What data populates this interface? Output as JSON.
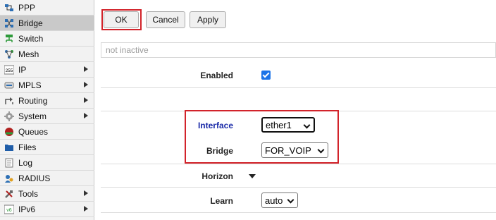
{
  "sidebar": {
    "items": [
      {
        "label": "PPP",
        "icon": "ppp-icon",
        "has_arrow": false,
        "active": false
      },
      {
        "label": "Bridge",
        "icon": "bridge-icon",
        "has_arrow": false,
        "active": true
      },
      {
        "label": "Switch",
        "icon": "switch-icon",
        "has_arrow": false,
        "active": false
      },
      {
        "label": "Mesh",
        "icon": "mesh-icon",
        "has_arrow": false,
        "active": false
      },
      {
        "label": "IP",
        "icon": "ip-icon",
        "has_arrow": true,
        "active": false
      },
      {
        "label": "MPLS",
        "icon": "mpls-icon",
        "has_arrow": true,
        "active": false
      },
      {
        "label": "Routing",
        "icon": "routing-icon",
        "has_arrow": true,
        "active": false
      },
      {
        "label": "System",
        "icon": "system-icon",
        "has_arrow": true,
        "active": false
      },
      {
        "label": "Queues",
        "icon": "queues-icon",
        "has_arrow": false,
        "active": false
      },
      {
        "label": "Files",
        "icon": "files-icon",
        "has_arrow": false,
        "active": false
      },
      {
        "label": "Log",
        "icon": "log-icon",
        "has_arrow": false,
        "active": false
      },
      {
        "label": "RADIUS",
        "icon": "radius-icon",
        "has_arrow": false,
        "active": false
      },
      {
        "label": "Tools",
        "icon": "tools-icon",
        "has_arrow": true,
        "active": false
      },
      {
        "label": "IPv6",
        "icon": "ipv6-icon",
        "has_arrow": true,
        "active": false
      }
    ],
    "ip_icon_text": "255",
    "ipv6_icon_text": "v6"
  },
  "toolbar": {
    "ok_label": "OK",
    "cancel_label": "Cancel",
    "apply_label": "Apply"
  },
  "status": {
    "text": "not inactive"
  },
  "form": {
    "enabled_label": "Enabled",
    "enabled_checked": true,
    "interface_label": "Interface",
    "interface_value": "ether1",
    "bridge_label": "Bridge",
    "bridge_value": "FOR_VOIP",
    "horizon_label": "Horizon",
    "learn_label": "Learn",
    "learn_value": "auto"
  },
  "colors": {
    "highlight_red": "#d2232a",
    "interface_label_blue": "#1a2aa8",
    "checkbox_blue": "#1a73e8",
    "sidebar_active": "#c9c9c9"
  }
}
